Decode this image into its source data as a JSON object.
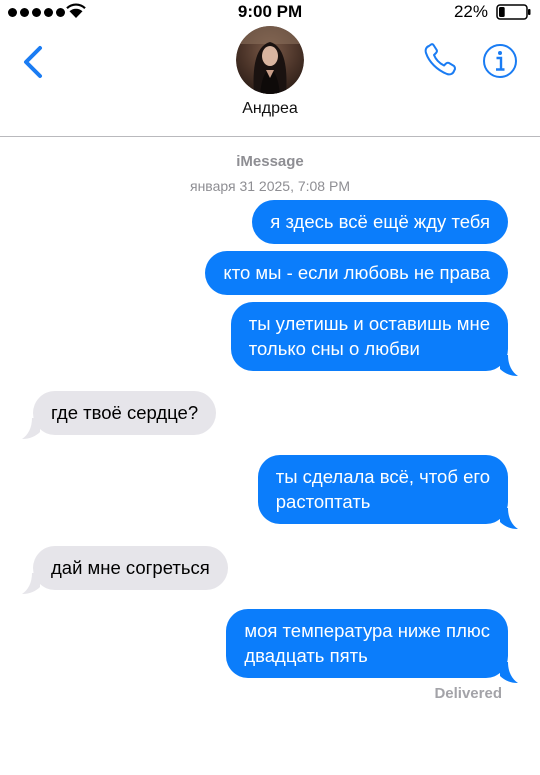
{
  "status_bar": {
    "time": "9:00 PM",
    "battery_percent": "22%",
    "battery_level": 0.22
  },
  "header": {
    "contact_name": "Андреа"
  },
  "conversation": {
    "service": "iMessage",
    "timestamp": "января 31 2025, 7:08 PM",
    "messages": [
      {
        "direction": "sent",
        "text": "я здесь всё ещё жду тебя"
      },
      {
        "direction": "sent",
        "text": "кто мы - если любовь не права"
      },
      {
        "direction": "sent",
        "line1": "ты улетишь и оставишь мне",
        "line2": "только сны о любви"
      },
      {
        "direction": "received",
        "text": "где твоё сердце?"
      },
      {
        "direction": "sent",
        "line1": "ты сделала всё, чтоб его",
        "line2": "растоптать"
      },
      {
        "direction": "received",
        "text": "дай мне согреться"
      },
      {
        "direction": "sent",
        "line1": "моя температура ниже плюс",
        "line2": "двадцать пять"
      }
    ],
    "delivery_status": "Delivered"
  },
  "colors": {
    "accent": "#1a7cf3",
    "sent_bubble": "#0b7dfb",
    "received_bubble": "#e6e5ea",
    "meta_text": "#8e8e93"
  },
  "icons": [
    "signal-dots-icon",
    "wifi-icon",
    "battery-icon",
    "back-chevron-icon",
    "phone-icon",
    "info-icon"
  ]
}
